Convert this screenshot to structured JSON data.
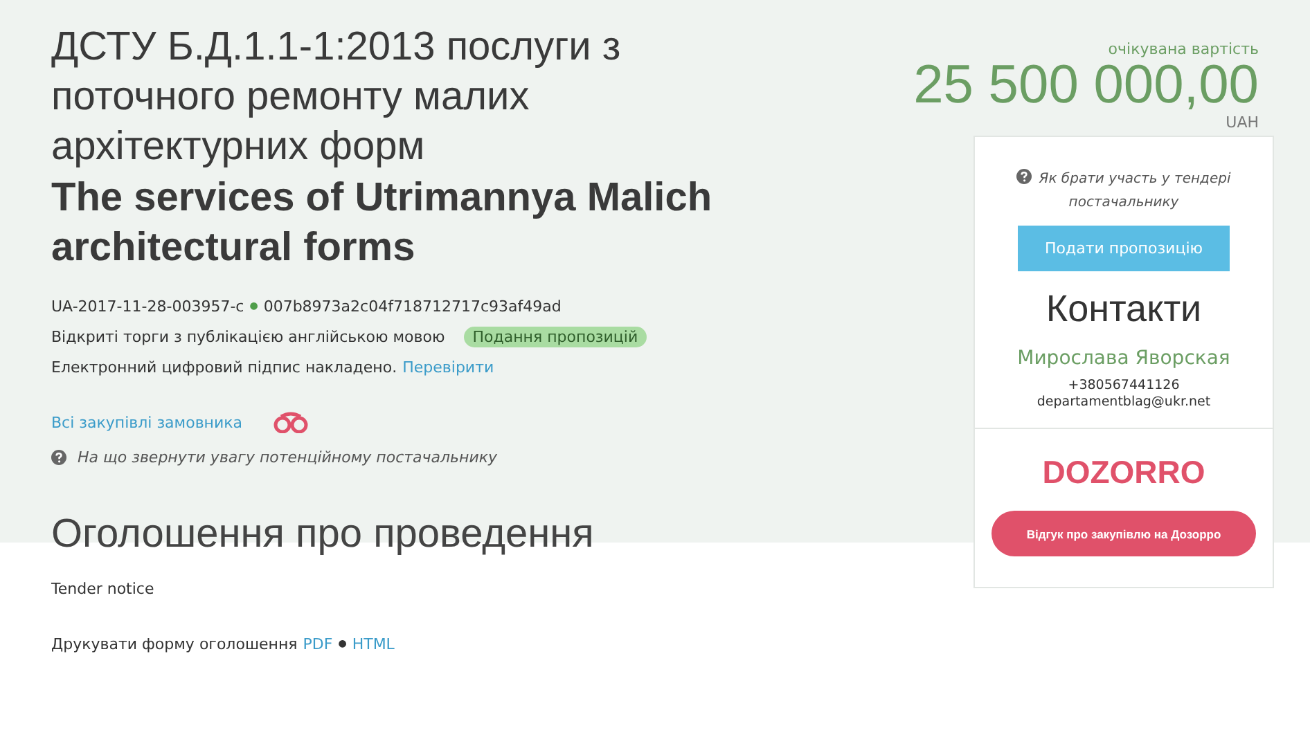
{
  "tender": {
    "title": "ДСТУ Б.Д.1.1-1:2013 послуги з поточного ремонту малих архітектурних форм",
    "title_en": "The services of Utrimannya Malich architectural forms",
    "id": "UA-2017-11-28-003957-c",
    "separator": "●",
    "hash": "007b8973a2c04f718712717c93af49ad",
    "procedure": "Відкриті торги з публікацією англійською мовою",
    "status": "Подання пропозицій",
    "signature": "Електронний цифровий підпис накладено.",
    "verify_link": "Перевірити",
    "buyer_link": "Всі закупівлі замовника",
    "hint": "На що звернути увагу потенційному постачальнику"
  },
  "price": {
    "label": "очікувана вартість",
    "amount": "25 500 000,00",
    "currency": "UAH"
  },
  "card": {
    "help": "Як брати участь у тендері постачальнику",
    "submit_button": "Подати пропозицію",
    "contacts_title": "Контакти",
    "contact_name": "Мирослава Яворская",
    "phone": "+380567441126",
    "email": "departamentblag@ukr.net",
    "logo": "DOZORRO",
    "feedback_button": "Відгук про закупівлю на Дозорро"
  },
  "notice": {
    "heading": "Оголошення про проведення",
    "subtitle": "Tender notice",
    "print_label": "Друкувати форму оголошення",
    "links": [
      "PDF",
      "HTML"
    ],
    "separator": "●"
  }
}
